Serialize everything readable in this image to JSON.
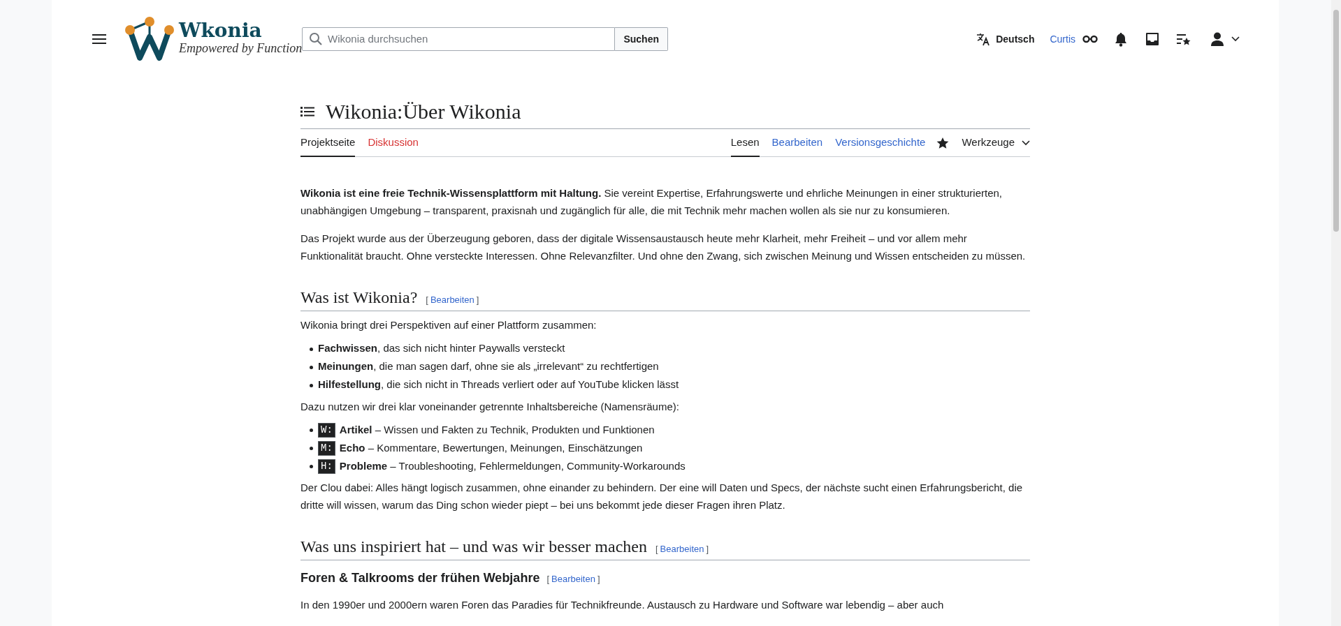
{
  "header": {
    "brand": "Wkonia",
    "tagline": "Empowered by Function",
    "search": {
      "placeholder": "Wikonia durchsuchen",
      "button": "Suchen"
    },
    "language": "Deutsch",
    "username": "Curtis"
  },
  "page": {
    "title": "Wikonia:Über Wikonia",
    "tabs_left": [
      {
        "label": "Projektseite",
        "selected": true,
        "kind": "existing"
      },
      {
        "label": "Diskussion",
        "selected": false,
        "kind": "missing"
      }
    ],
    "tabs_right": [
      {
        "label": "Lesen",
        "selected": true
      },
      {
        "label": "Bearbeiten",
        "selected": false
      },
      {
        "label": "Versionsgeschichte",
        "selected": false
      }
    ],
    "tools": "Werkzeuge",
    "content": [
      {
        "kind": "paragraph",
        "text": "**Wikonia ist eine freie Technik-Wissensplattform mit Haltung.** Sie vereint Expertise, Erfahrungswerte und ehrliche Meinungen in einer strukturierten, unabhängigen Umgebung – transparent, praxisnah und zugänglich für alle, die mit Technik mehr machen wollen als sie nur zu konsumieren."
      },
      {
        "kind": "paragraph",
        "text": "Das Projekt wurde aus der Überzeugung geboren, dass der digitale Wissensaustausch heute mehr Klarheit, mehr Freiheit – und vor allem mehr Funktionalität braucht. Ohne versteckte Interessen. Ohne Relevanzfilter. Und ohne den Zwang, sich zwischen Meinung und Wissen entscheiden zu müssen."
      },
      {
        "kind": "heading2",
        "text": "Was ist Wikonia?",
        "edit": {
          "open": "[",
          "label": "Bearbeiten",
          "close": "]"
        }
      },
      {
        "kind": "paragraph",
        "text": "Wikonia bringt drei Perspektiven auf einer Plattform zusammen:"
      },
      {
        "kind": "list",
        "items": [
          {
            "text": "**Fachwissen**, das sich nicht hinter Paywalls versteckt"
          },
          {
            "text": "**Meinungen**, die man sagen darf, ohne sie als „irrelevant“ zu rechtfertigen"
          },
          {
            "text": "**Hilfestellung**, die sich nicht in Threads verliert oder auf YouTube klicken lässt"
          }
        ]
      },
      {
        "kind": "paragraph",
        "text": "Dazu nutzen wir drei klar voneinander getrennte Inhaltsbereiche (Namensräume):"
      },
      {
        "kind": "list",
        "items": [
          {
            "prefix": "W:",
            "text": "**Artikel** – Wissen und Fakten zu Technik, Produkten und Funktionen"
          },
          {
            "prefix": "M:",
            "text": "**Echo** – Kommentare, Bewertungen, Meinungen, Einschätzungen"
          },
          {
            "prefix": "H:",
            "text": "**Probleme** – Troubleshooting, Fehlermeldungen, Community-Workarounds"
          }
        ]
      },
      {
        "kind": "paragraph",
        "text": "Der Clou dabei: Alles hängt logisch zusammen, ohne einander zu behindern. Der eine will Daten und Specs, der nächste sucht einen Erfahrungsbericht, die dritte will wissen, warum das Ding schon wieder piept – bei uns bekommt jede dieser Fragen ihren Platz."
      },
      {
        "kind": "heading2",
        "text": "Was uns inspiriert hat – und was wir besser machen",
        "edit": {
          "open": "[",
          "label": "Bearbeiten",
          "close": "]"
        }
      },
      {
        "kind": "heading3",
        "text": "Foren & Talkrooms der frühen Webjahre",
        "edit": {
          "open": "[",
          "label": "Bearbeiten",
          "close": "]"
        }
      },
      {
        "kind": "paragraph",
        "text": "In den 1990er und 2000ern waren Foren das Paradies für Technikfreunde. Austausch zu Hardware und Software war lebendig – aber auch"
      }
    ]
  }
}
